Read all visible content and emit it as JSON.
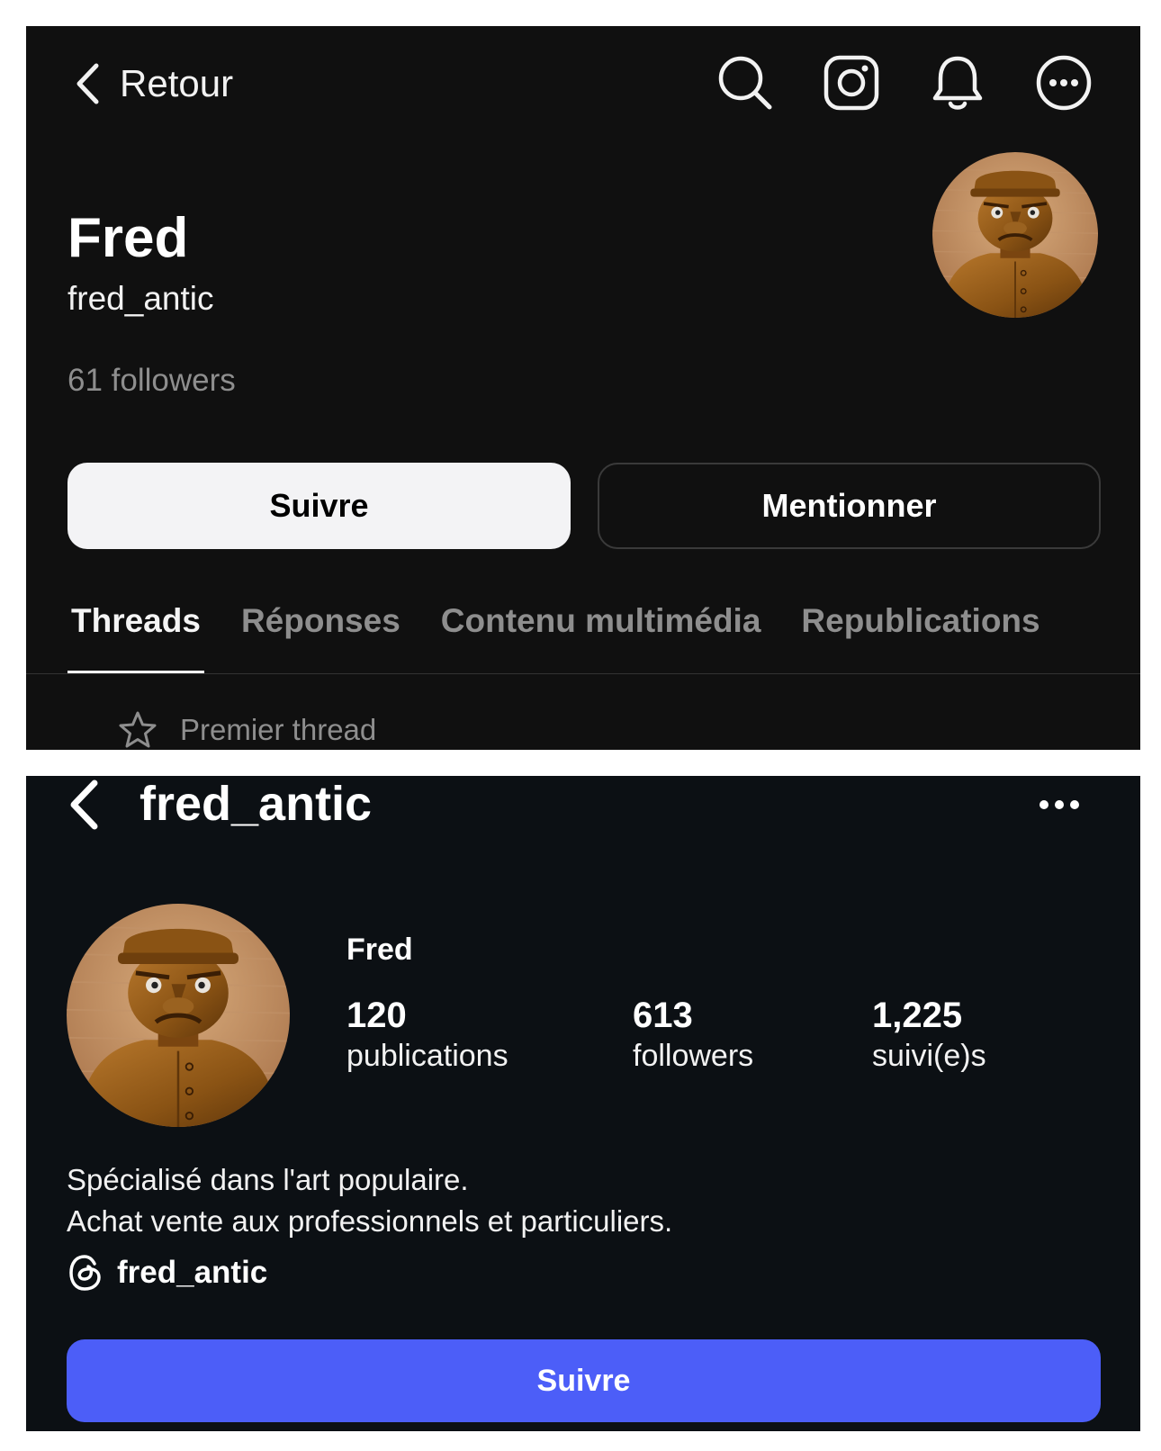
{
  "threads_profile": {
    "back_label": "Retour",
    "top_icons": [
      "search-icon",
      "instagram-icon",
      "bell-icon",
      "more-icon"
    ],
    "display_name": "Fred",
    "username": "fred_antic",
    "followers_text": "61 followers",
    "follow_button": "Suivre",
    "mention_button": "Mentionner",
    "tabs": [
      {
        "label": "Threads",
        "active": true
      },
      {
        "label": "Réponses",
        "active": false
      },
      {
        "label": "Contenu multimédia",
        "active": false
      },
      {
        "label": "Republications",
        "active": false
      }
    ],
    "pinned_label": "Premier thread"
  },
  "instagram_profile": {
    "header_title": "fred_antic",
    "display_name": "Fred",
    "stats": [
      {
        "value": "120",
        "label": "publications"
      },
      {
        "value": "613",
        "label": "followers"
      },
      {
        "value": "1,225",
        "label": "suivi(e)s"
      }
    ],
    "bio_lines": [
      "Spécialisé dans l'art populaire.",
      "Achat vente aux professionnels et particuliers."
    ],
    "threads_link": "fred_antic",
    "follow_button": "Suivre"
  },
  "colors": {
    "threads_bg": "#101010",
    "instagram_bg": "#0c1014",
    "instagram_accent": "#4c5ef8"
  }
}
